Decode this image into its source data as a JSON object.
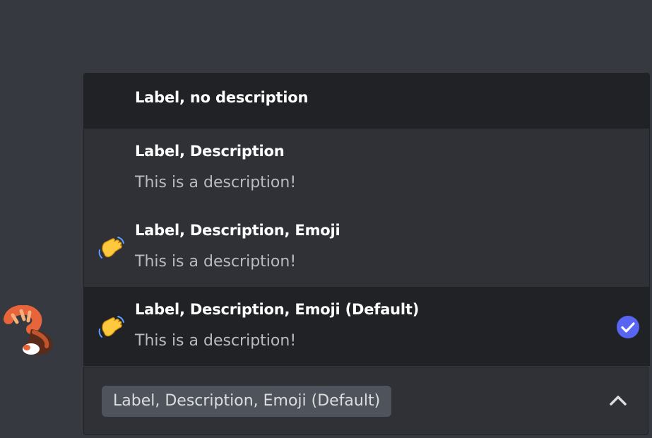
{
  "dropdown": {
    "options": [
      {
        "label": "Label, no description",
        "description": "",
        "emoji": "",
        "state": "hover"
      },
      {
        "label": "Label, Description",
        "description": "This is a description!",
        "emoji": "",
        "state": "normal"
      },
      {
        "label": "Label, Description, Emoji",
        "description": "This is a description!",
        "emoji": "waving-hand-icon",
        "state": "normal"
      },
      {
        "label": "Label, Description, Emoji (Default)",
        "description": "This is a description!",
        "emoji": "waving-hand-icon",
        "state": "selected"
      }
    ]
  },
  "select": {
    "value": "Label, Description, Emoji (Default)",
    "chevron": "chevron-up-icon"
  },
  "bot": {
    "avatar": "red-panda-avatar-icon"
  },
  "colors": {
    "background": "#36393f",
    "menu": "#2f3136",
    "highlight": "#202225",
    "chip": "#4f545c",
    "accent": "#5865f2",
    "description": "#b9bbbe"
  }
}
